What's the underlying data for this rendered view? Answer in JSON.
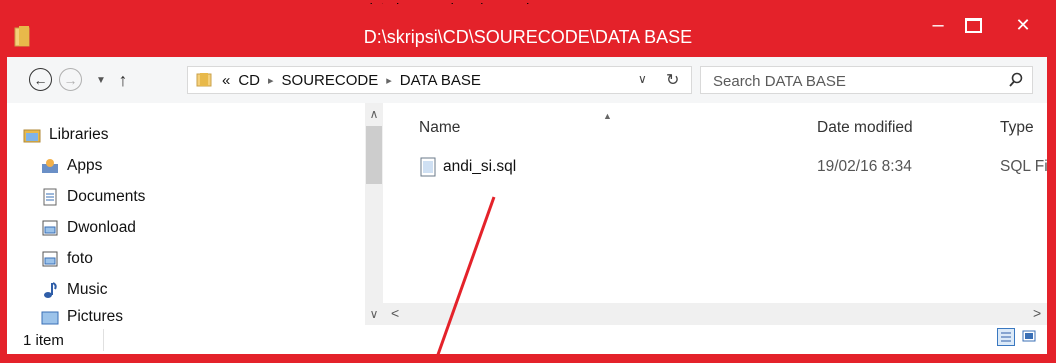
{
  "window": {
    "title": "D:\\skripsi\\CD\\SOURECODE\\DATA BASE",
    "top_cut_text": "data base pada sqlyog, adapun",
    "minimize": "–",
    "close": "✕"
  },
  "address": {
    "overflow": "«",
    "crumbs": [
      "CD",
      "SOURECODE",
      "DATA BASE"
    ],
    "sep": "▸"
  },
  "search": {
    "placeholder": "Search DATA BASE"
  },
  "nav": {
    "items": [
      {
        "label": "Libraries",
        "icon": "libraries-icon"
      },
      {
        "label": "Apps",
        "icon": "apps-icon"
      },
      {
        "label": "Documents",
        "icon": "documents-icon"
      },
      {
        "label": "Dwonload",
        "icon": "folder-icon"
      },
      {
        "label": "foto",
        "icon": "folder-icon"
      },
      {
        "label": "Music",
        "icon": "music-icon"
      },
      {
        "label": "Pictures",
        "icon": "pictures-icon"
      }
    ]
  },
  "columns": {
    "name": "Name",
    "date": "Date modified",
    "type": "Type"
  },
  "files": [
    {
      "name": "andi_si.sql",
      "date": "19/02/16 8:34",
      "type": "SQL File"
    }
  ],
  "status": {
    "count": "1 item"
  },
  "colors": {
    "frame": "#e4222a",
    "annotation": "#e4222a"
  }
}
